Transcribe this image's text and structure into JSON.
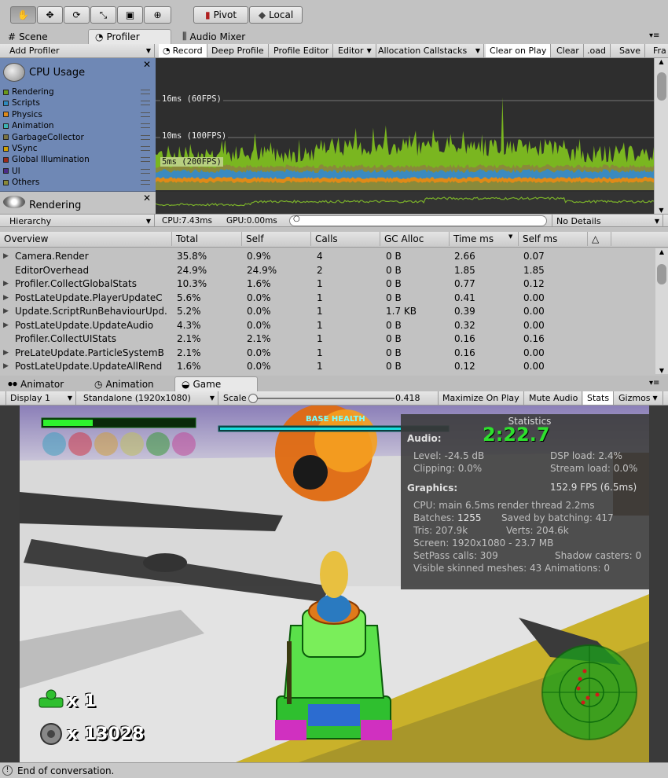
{
  "toolbar": {
    "pivot_label": "Pivot",
    "local_label": "Local"
  },
  "tabs": [
    {
      "label": "Scene"
    },
    {
      "label": "Profiler"
    },
    {
      "label": "Audio Mixer"
    }
  ],
  "profiler_toolbar": {
    "add_profiler": "Add Profiler",
    "record": "Record",
    "deep_profile": "Deep Profile",
    "profile_editor": "Profile Editor",
    "editor": "Editor",
    "allocation_callstacks": "Allocation Callstacks",
    "clear_on_play": "Clear on Play",
    "clear": "Clear",
    "load": ".oad",
    "save": "Save",
    "frame": "Fra"
  },
  "cpu_module": {
    "title": "CPU Usage",
    "items": [
      {
        "label": "Rendering",
        "color": "#6b9a1b"
      },
      {
        "label": "Scripts",
        "color": "#2f8bbf"
      },
      {
        "label": "Physics",
        "color": "#e08a18"
      },
      {
        "label": "Animation",
        "color": "#3cb4b4"
      },
      {
        "label": "GarbageCollector",
        "color": "#7a7240"
      },
      {
        "label": "VSync",
        "color": "#d0a000"
      },
      {
        "label": "Global Illumination",
        "color": "#9a2a1a"
      },
      {
        "label": "UI",
        "color": "#4b2a8a"
      },
      {
        "label": "Others",
        "color": "#8a8a3a"
      }
    ]
  },
  "rendering_module": {
    "title": "Rendering"
  },
  "graph": {
    "line16": "16ms (60FPS)",
    "line10": "10ms (100FPS)",
    "line5": "5ms (200FPS)"
  },
  "hierarchy_bar": {
    "view": "Hierarchy",
    "cpu": "CPU:7.43ms",
    "gpu": "GPU:0.00ms",
    "details": "No Details"
  },
  "table": {
    "headers": [
      "Overview",
      "Total",
      "Self",
      "Calls",
      "GC Alloc",
      "Time ms",
      "Self ms"
    ],
    "rows": [
      {
        "name": "Camera.Render",
        "total": "35.8%",
        "self": "0.9%",
        "calls": "4",
        "gc": "0 B",
        "time": "2.66",
        "selfms": "0.07",
        "arrow": true
      },
      {
        "name": "EditorOverhead",
        "total": "24.9%",
        "self": "24.9%",
        "calls": "2",
        "gc": "0 B",
        "time": "1.85",
        "selfms": "1.85",
        "arrow": false
      },
      {
        "name": "Profiler.CollectGlobalStats",
        "total": "10.3%",
        "self": "1.6%",
        "calls": "1",
        "gc": "0 B",
        "time": "0.77",
        "selfms": "0.12",
        "arrow": true
      },
      {
        "name": "PostLateUpdate.PlayerUpdateC",
        "total": "5.6%",
        "self": "0.0%",
        "calls": "1",
        "gc": "0 B",
        "time": "0.41",
        "selfms": "0.00",
        "arrow": true
      },
      {
        "name": "Update.ScriptRunBehaviourUpd.",
        "total": "5.2%",
        "self": "0.0%",
        "calls": "1",
        "gc": "1.7 KB",
        "time": "0.39",
        "selfms": "0.00",
        "arrow": true
      },
      {
        "name": "PostLateUpdate.UpdateAudio",
        "total": "4.3%",
        "self": "0.0%",
        "calls": "1",
        "gc": "0 B",
        "time": "0.32",
        "selfms": "0.00",
        "arrow": true
      },
      {
        "name": "Profiler.CollectUIStats",
        "total": "2.1%",
        "self": "2.1%",
        "calls": "1",
        "gc": "0 B",
        "time": "0.16",
        "selfms": "0.16",
        "arrow": false
      },
      {
        "name": "PreLateUpdate.ParticleSystemB",
        "total": "2.1%",
        "self": "0.0%",
        "calls": "1",
        "gc": "0 B",
        "time": "0.16",
        "selfms": "0.00",
        "arrow": true
      },
      {
        "name": "PostLateUpdate.UpdateAllRend",
        "total": "1.6%",
        "self": "0.0%",
        "calls": "1",
        "gc": "0 B",
        "time": "0.12",
        "selfms": "0.00",
        "arrow": true
      }
    ]
  },
  "bottom_tabs": [
    {
      "label": "Animator"
    },
    {
      "label": "Animation"
    },
    {
      "label": "Game"
    }
  ],
  "game_toolbar": {
    "display": "Display 1",
    "resolution": "Standalone (1920x1080)",
    "scale_label": "Scale",
    "scale_value": "0.418",
    "maximize": "Maximize On Play",
    "mute": "Mute Audio",
    "stats": "Stats",
    "gizmos": "Gizmos"
  },
  "hud": {
    "base_health": "BASE HEALTH",
    "timer": "2:22.7",
    "lives": "x 1",
    "score": "x 13028"
  },
  "stats": {
    "title": "Statistics",
    "audio_header": "Audio:",
    "level": "Level: -24.5 dB",
    "clipping": "Clipping: 0.0%",
    "dsp": "DSP load: 2.4%",
    "stream": "Stream load: 0.0%",
    "graphics_header": "Graphics:",
    "fps": "152.9 FPS (6.5ms)",
    "cpu": "CPU: main 6.5ms  render thread 2.2ms",
    "batches_label": "Batches: ",
    "batches_value": "1255",
    "saved": "Saved by batching: 417",
    "tris": "Tris: 207.9k",
    "verts": "Verts: 204.6k",
    "screen": "Screen: 1920x1080 - 23.7 MB",
    "setpass": "SetPass calls: 309",
    "shadow": "Shadow casters: 0",
    "skinned": "Visible skinned meshes: 43  Animations: 0"
  },
  "status": {
    "text": "End of conversation."
  }
}
